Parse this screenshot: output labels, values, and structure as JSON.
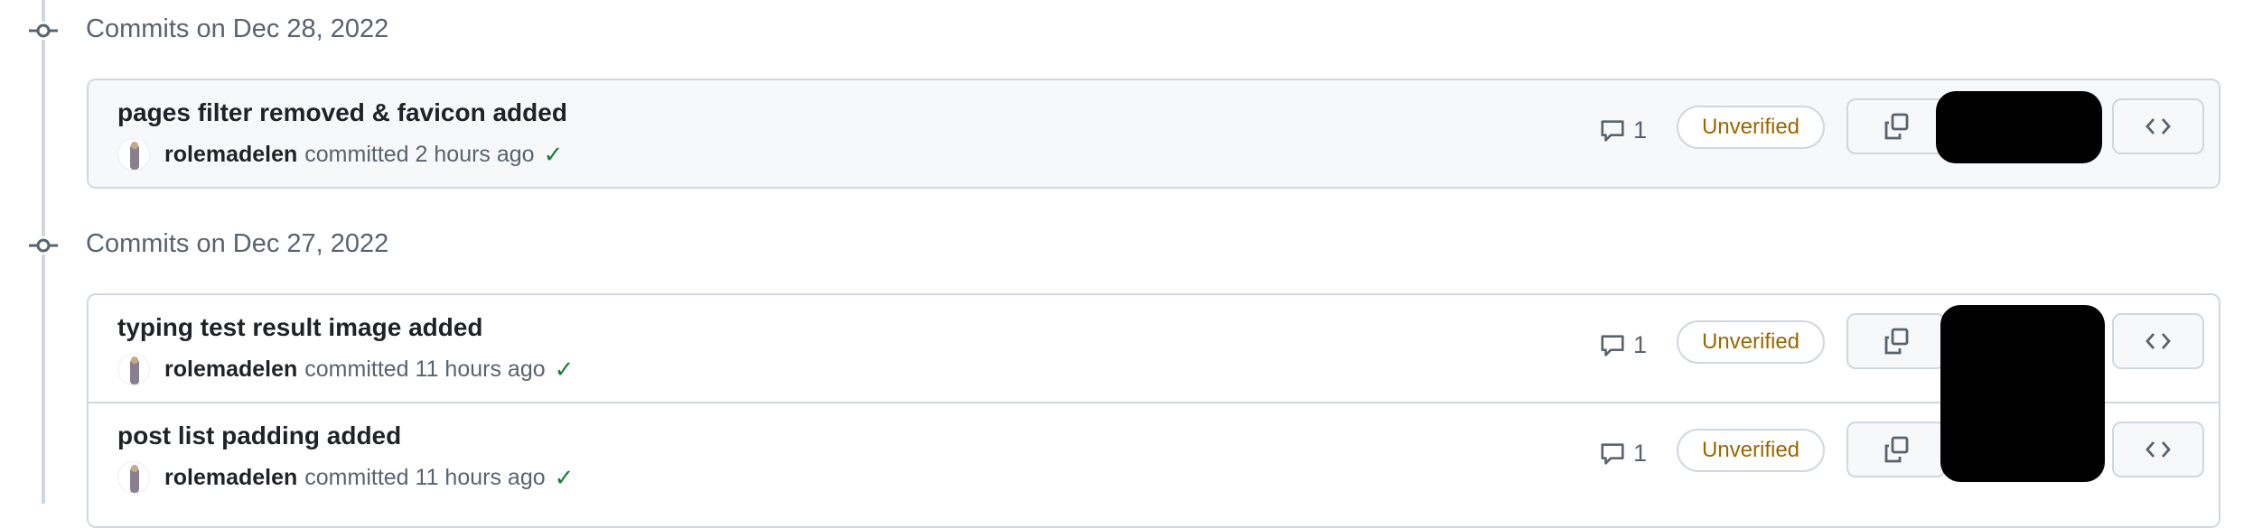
{
  "groups": [
    {
      "date": "Commits on Dec 28, 2022",
      "commits": [
        {
          "title": "pages filter removed & favicon added",
          "author": "rolemadelen",
          "action": "committed 2 hours ago",
          "status": "✓",
          "comments": "1",
          "badge": "Unverified"
        }
      ]
    },
    {
      "date": "Commits on Dec 27, 2022",
      "commits": [
        {
          "title": "typing test result image added",
          "author": "rolemadelen",
          "action": "committed 11 hours ago",
          "status": "✓",
          "comments": "1",
          "badge": "Unverified"
        },
        {
          "title": "post list padding added",
          "author": "rolemadelen",
          "action": "committed 11 hours ago",
          "status": "✓",
          "comments": "1",
          "badge": "Unverified"
        }
      ]
    }
  ],
  "colors": {
    "badge": "#9a6700",
    "check": "#1a7f37",
    "border": "#d0d7de"
  }
}
